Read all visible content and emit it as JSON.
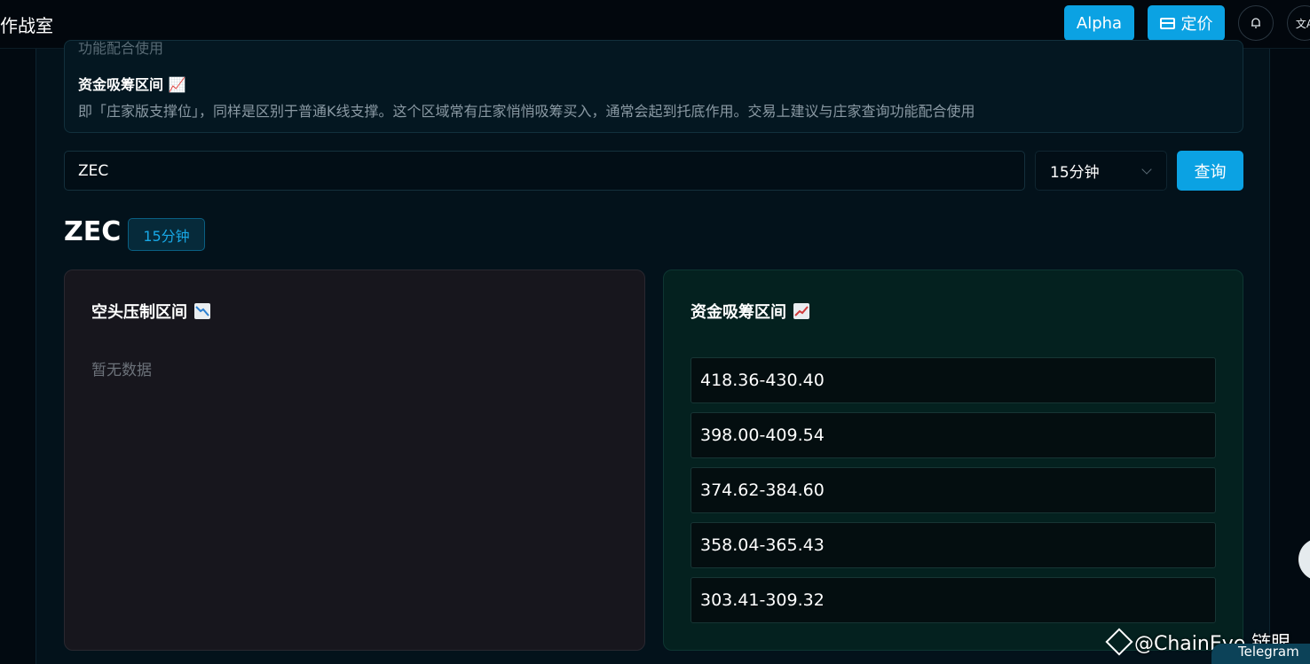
{
  "header": {
    "title": "作战室",
    "alpha_label": "Alpha",
    "pricing_label": "定价",
    "bell_icon": "bell-icon",
    "translate_icon": "translate-icon"
  },
  "info": {
    "cut_text": "功能配合使用",
    "title": "资金吸筹区间 📈",
    "desc": "即「庄家版支撑位」，同样是区别于普通K线支撑。这个区域常有庄家悄悄吸筹买入，通常会起到托底作用。交易上建议与庄家查询功能配合使用"
  },
  "search": {
    "value": "ZEC",
    "interval_selected": "15分钟",
    "query_label": "查询"
  },
  "result": {
    "symbol": "ZEC",
    "interval_badge": "15分钟",
    "short_panel": {
      "title": "空头压制区间",
      "empty_text": "暂无数据"
    },
    "long_panel": {
      "title": "资金吸筹区间",
      "zones": [
        "418.36-430.40",
        "398.00-409.54",
        "374.62-384.60",
        "358.04-365.43",
        "303.41-309.32"
      ]
    }
  },
  "overlay": {
    "watermark": "@ChainEye 链眼",
    "telegram": "Telegram"
  },
  "colors": {
    "accent": "#0ba2e3",
    "short_panel_bg": "#17161d",
    "long_panel_bg": "#04211f"
  }
}
